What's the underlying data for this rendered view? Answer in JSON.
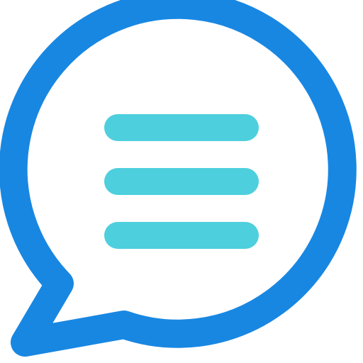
{
  "icon": {
    "name": "chat-bubble-icon",
    "outline_color": "#1887E2",
    "line_color": "#4ECFDD",
    "background_color": "#FFFFFF",
    "text_line_count": 3
  }
}
